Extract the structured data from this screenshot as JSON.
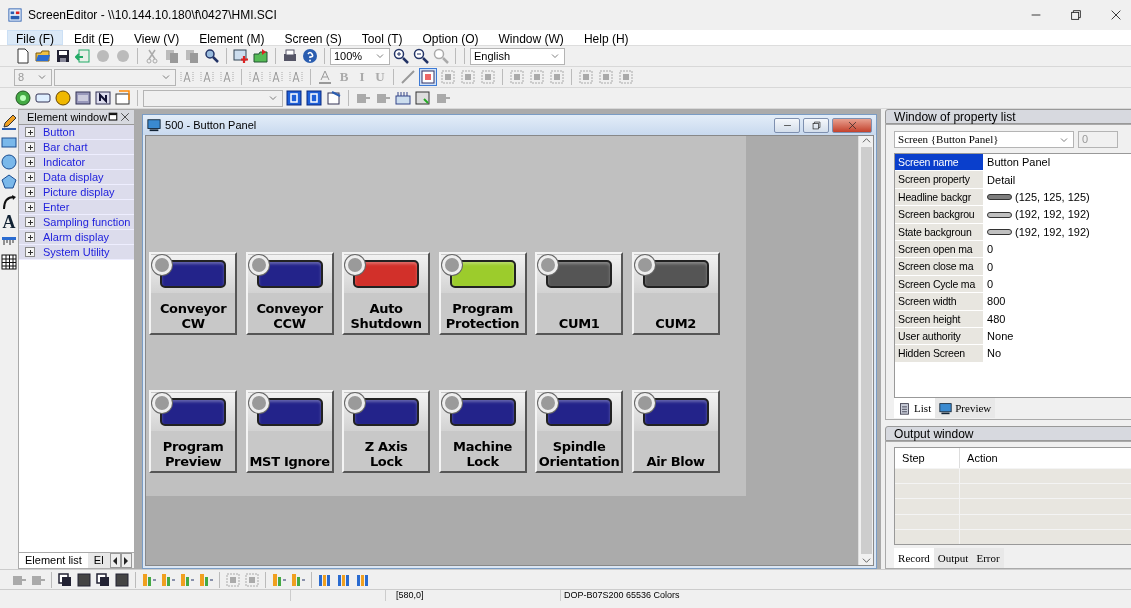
{
  "window": {
    "title": "ScreenEditor - \\\\10.144.10.180\\f\\0427\\HMI.SCI"
  },
  "menu": [
    {
      "label": "File (F)",
      "selected": true
    },
    {
      "label": "Edit (E)",
      "selected": false
    },
    {
      "label": "View (V)",
      "selected": false
    },
    {
      "label": "Element (M)",
      "selected": false
    },
    {
      "label": "Screen (S)",
      "selected": false
    },
    {
      "label": "Tool (T)",
      "selected": false
    },
    {
      "label": "Option (O)",
      "selected": false
    },
    {
      "label": "Window (W)",
      "selected": false
    },
    {
      "label": "Help (H)",
      "selected": false
    }
  ],
  "toolbar": {
    "zoom": "100%",
    "language": "English",
    "font_size": "8",
    "format_buttons": [
      "B",
      "I",
      "U"
    ]
  },
  "left_tools": [
    {
      "kind": "pencil"
    },
    {
      "kind": "rectangle"
    },
    {
      "kind": "circle"
    },
    {
      "kind": "pentagon"
    },
    {
      "kind": "arc"
    },
    {
      "kind": "text",
      "glyph": "A"
    },
    {
      "kind": "scale"
    },
    {
      "kind": "table"
    }
  ],
  "element_window": {
    "title": "Element window",
    "items": [
      {
        "label": "Button",
        "expanded": false
      },
      {
        "label": "Bar chart",
        "expanded": false
      },
      {
        "label": "Indicator",
        "expanded": false
      },
      {
        "label": "Data display",
        "expanded": false
      },
      {
        "label": "Picture display",
        "expanded": false
      },
      {
        "label": "Enter",
        "expanded": false
      },
      {
        "label": "Sampling function",
        "expanded": false
      },
      {
        "label": "Alarm display",
        "expanded": false
      },
      {
        "label": "System Utility",
        "expanded": false
      }
    ],
    "tabs": [
      {
        "label": "Element list",
        "selected": true
      },
      {
        "label": "El",
        "selected": false
      }
    ]
  },
  "screen_window": {
    "title": "500 - Button Panel",
    "buttons": [
      {
        "label": "Conveyor\nCW",
        "color": "#23238a"
      },
      {
        "label": "Conveyor\nCCW",
        "color": "#23238a"
      },
      {
        "label": "Auto\nShutdown",
        "color": "#d2302a"
      },
      {
        "label": "Program\nProtection",
        "color": "#9ccc2c"
      },
      {
        "label": "CUM1",
        "color": "#555555"
      },
      {
        "label": "CUM2",
        "color": "#555555"
      },
      {
        "label": "Program\nPreview",
        "color": "#23238a"
      },
      {
        "label": "MST Ignore",
        "color": "#23238a"
      },
      {
        "label": "Z Axis\nLock",
        "color": "#23238a"
      },
      {
        "label": "Machine\nLock",
        "color": "#23238a"
      },
      {
        "label": "Spindle\nOrientation",
        "color": "#23238a"
      },
      {
        "label": "Air Blow",
        "color": "#23238a"
      }
    ]
  },
  "property_window": {
    "title": "Window of property list",
    "target": "Screen {Button Panel}",
    "index": "0",
    "rows": [
      {
        "name": "Screen name",
        "value": "Button Panel",
        "selected": true
      },
      {
        "name": "Screen property",
        "value": "Detail",
        "selected": false
      },
      {
        "name": "Headline backgr",
        "value": "(125, 125, 125)",
        "kind": "color",
        "selected": false
      },
      {
        "name": "Screen backgrou",
        "value": "(192, 192, 192)",
        "kind": "color",
        "selected": false
      },
      {
        "name": "State backgroun",
        "value": "(192, 192, 192)",
        "kind": "color",
        "selected": false
      },
      {
        "name": "Screen open ma",
        "value": "0",
        "selected": false
      },
      {
        "name": "Screen close ma",
        "value": "0",
        "selected": false
      },
      {
        "name": "Screen Cycle ma",
        "value": "0",
        "selected": false
      },
      {
        "name": "Screen width",
        "value": "800",
        "selected": false
      },
      {
        "name": "Screen height",
        "value": "480",
        "selected": false
      },
      {
        "name": "User authority",
        "value": "None",
        "selected": false
      },
      {
        "name": "Hidden Screen",
        "value": "No",
        "selected": false
      }
    ],
    "tabs": [
      {
        "label": "List",
        "selected": true
      },
      {
        "label": "Preview",
        "selected": false
      }
    ]
  },
  "output_window": {
    "title": "Output window",
    "columns": [
      "Step",
      "Action"
    ],
    "tabs": [
      {
        "label": "Record",
        "selected": true
      },
      {
        "label": "Output",
        "selected": false
      },
      {
        "label": "Error",
        "selected": false
      }
    ]
  },
  "status_bar": [
    "[580,0]",
    "DOP-B07S200 65536 Colors"
  ]
}
